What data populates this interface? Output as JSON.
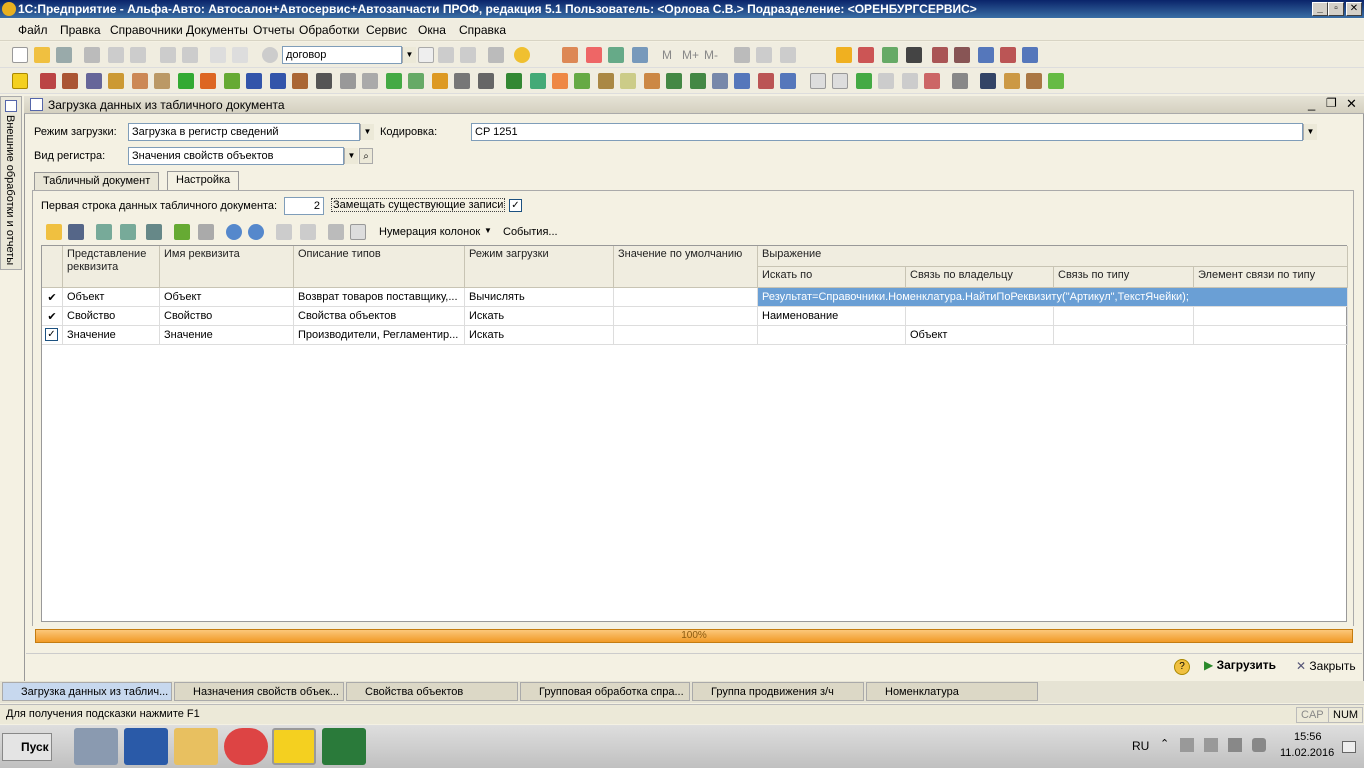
{
  "window": {
    "title": "1С:Предприятие - Альфа-Авто: Автосалон+Автосервис+Автозапчасти ПРОФ, редакция 5.1    Пользователь: <Орлова С.В.>    Подразделение: <ОРЕНБУРГСЕРВИС>"
  },
  "menu": [
    "Файл",
    "Правка",
    "Справочники",
    "Документы",
    "Отчеты",
    "Обработки",
    "Сервис",
    "Окна",
    "Справка"
  ],
  "toolbar": {
    "search_value": "договор",
    "labels": [
      "М",
      "М+",
      "М-"
    ]
  },
  "side_panel": {
    "label": "Внешние обработки и отчеты"
  },
  "form": {
    "title": "Загрузка данных из табличного документа",
    "mode_label": "Режим загрузки:",
    "mode_value": "Загрузка в регистр сведений",
    "encoding_label": "Кодировка:",
    "encoding_value": "CP 1251",
    "register_label": "Вид регистра:",
    "register_value": "Значения свойств объектов",
    "tabs": [
      "Табличный документ",
      "Настройка"
    ],
    "first_row_label": "Первая строка данных табличного документа:",
    "first_row_value": "2",
    "replace_label": "Замещать существующие записи",
    "toolbar_numbering": "Нумерация колонок",
    "toolbar_events": "События..."
  },
  "grid": {
    "headers": {
      "col1": "Представление реквизита",
      "col2": "Имя реквизита",
      "col3": "Описание типов",
      "col4": "Режим загрузки",
      "col5": "Значение по умолчанию",
      "expr": "Выражение",
      "sub1": "Искать по",
      "sub2": "Связь по владельцу",
      "sub3": "Связь по типу",
      "sub4": "Элемент связи по типу"
    },
    "rows": [
      {
        "rep": "Объект",
        "name": "Объект",
        "types": "Возврат товаров поставщику,...",
        "mode": "Вычислять",
        "def": "",
        "search": "Результат=Справочники.Номенклатура.НайтиПоРеквизиту(\"Артикул\",ТекстЯчейки);",
        "owner": "",
        "bytype": "",
        "elem": ""
      },
      {
        "rep": "Свойство",
        "name": "Свойство",
        "types": "Свойства объектов",
        "mode": "Искать",
        "def": "",
        "search": "Наименование",
        "owner": "",
        "bytype": "",
        "elem": ""
      },
      {
        "rep": "Значение",
        "name": "Значение",
        "types": "Производители, Регламентир...",
        "mode": "Искать",
        "def": "",
        "search": "",
        "owner": "Объект",
        "bytype": "",
        "elem": ""
      }
    ]
  },
  "progress": {
    "text": "100%",
    "value": 100
  },
  "bottom": {
    "load": "Загрузить",
    "close": "Закрыть"
  },
  "tasks": [
    "Загрузка данных из таблич...",
    "Назначения свойств объек...",
    "Свойства объектов",
    "Групповая обработка спра...",
    "Группа продвижения з/ч",
    "Номенклатура"
  ],
  "status": {
    "hint": "Для получения подсказки нажмите F1",
    "cap": "CAP",
    "num": "NUM"
  },
  "taskbar": {
    "start": "Пуск",
    "lang": "RU",
    "time": "15:56",
    "date": "11.02.2016"
  }
}
